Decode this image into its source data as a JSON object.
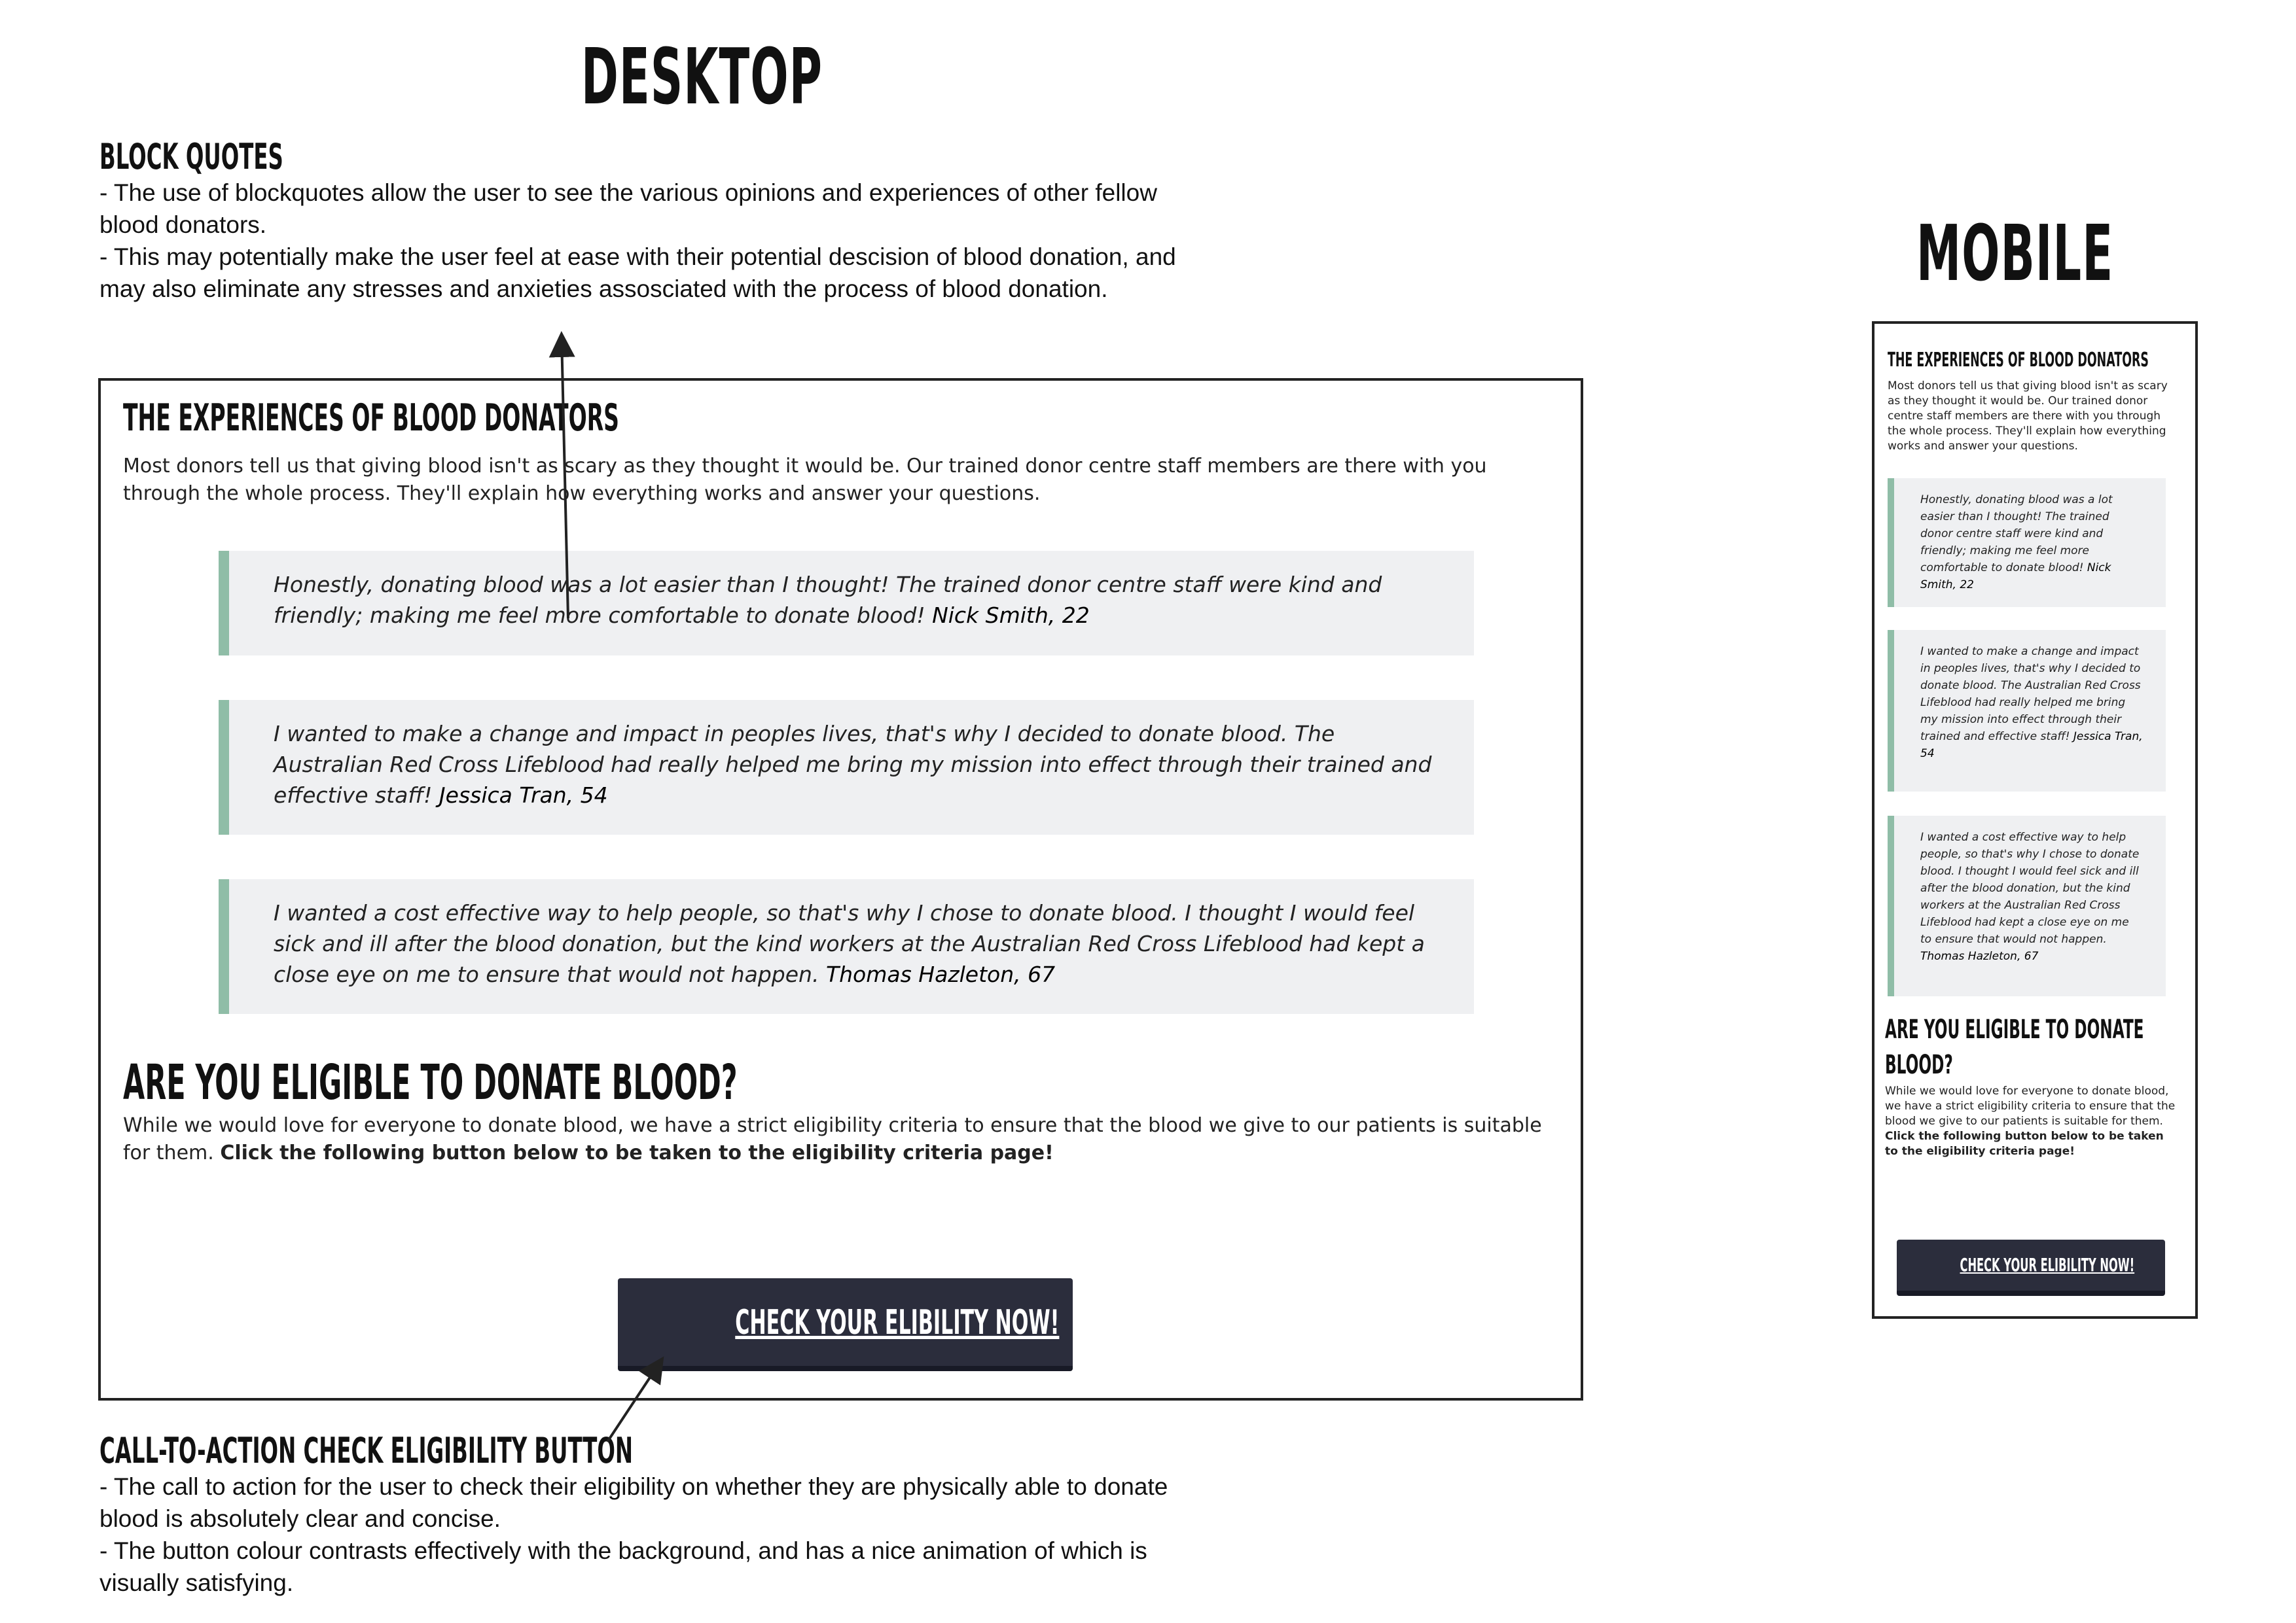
{
  "board": {
    "desktop_heading": "DESKTOP",
    "mobile_heading": "MOBILE"
  },
  "notes": {
    "blockquotes": {
      "title": "BLOCK QUOTES",
      "lines": [
        "- The use of blockquotes allow the user to see the various opinions and experiences of other fellow blood donators.",
        "- This may potentially make the user feel at ease with their potential descision of blood donation, and may also eliminate any stresses and anxieties assosciated with the process of blood donation."
      ]
    },
    "cta": {
      "title": "CALL-TO-ACTION CHECK ELIGIBILITY BUTTON",
      "lines": [
        "- The call to action for the user to check their eligibility on whether they are physically able to donate blood is absolutely clear and concise.",
        "- The button colour contrasts effectively with the background, and has a nice animation of which is visually satisfying."
      ]
    }
  },
  "page": {
    "experiences_heading": "THE EXPERIENCES OF BLOOD DONATORS",
    "experiences_intro": "Most donors tell us that giving blood isn't as scary as they thought it would be. Our trained donor centre staff members are there with you through the whole process. They'll explain how everything works and answer your questions.",
    "quotes": [
      {
        "text": "Honestly, donating blood was a lot easier than I thought! The trained donor centre staff were kind and friendly; making me feel more comfortable to donate blood!",
        "author": "Nick Smith, 22"
      },
      {
        "text": "I wanted to make a change and impact in peoples lives, that's why I decided to donate blood. The Australian Red Cross Lifeblood had really helped me bring my mission into effect through their trained and effective staff!",
        "author": "Jessica Tran, 54"
      },
      {
        "text": "I wanted a cost effective way to help people, so that's why I chose to donate blood. I thought I would feel sick and ill after the blood donation, but the kind workers at the Australian Red Cross Lifeblood had kept a close eye on me to ensure that would not happen.",
        "author": "Thomas Hazleton, 67"
      }
    ],
    "eligible_heading": "ARE YOU ELIGIBLE TO DONATE BLOOD?",
    "eligible_heading_mobile_line1": "ARE YOU ELIGIBLE TO DONATE",
    "eligible_heading_mobile_line2": "BLOOD?",
    "eligible_text": "While we would love for everyone to donate blood, we have a strict eligibility criteria to ensure that the blood we give to our patients is suitable for them.",
    "eligible_text_bold": "Click the following button below to be taken to the eligibility criteria page!",
    "cta_label": "CHECK YOUR ELIBILITY NOW!"
  },
  "colors": {
    "quote_border": "#8fbda7",
    "quote_bg": "#eff0f2",
    "cta_bg": "#2b2d3c",
    "frame_border": "#222222"
  }
}
